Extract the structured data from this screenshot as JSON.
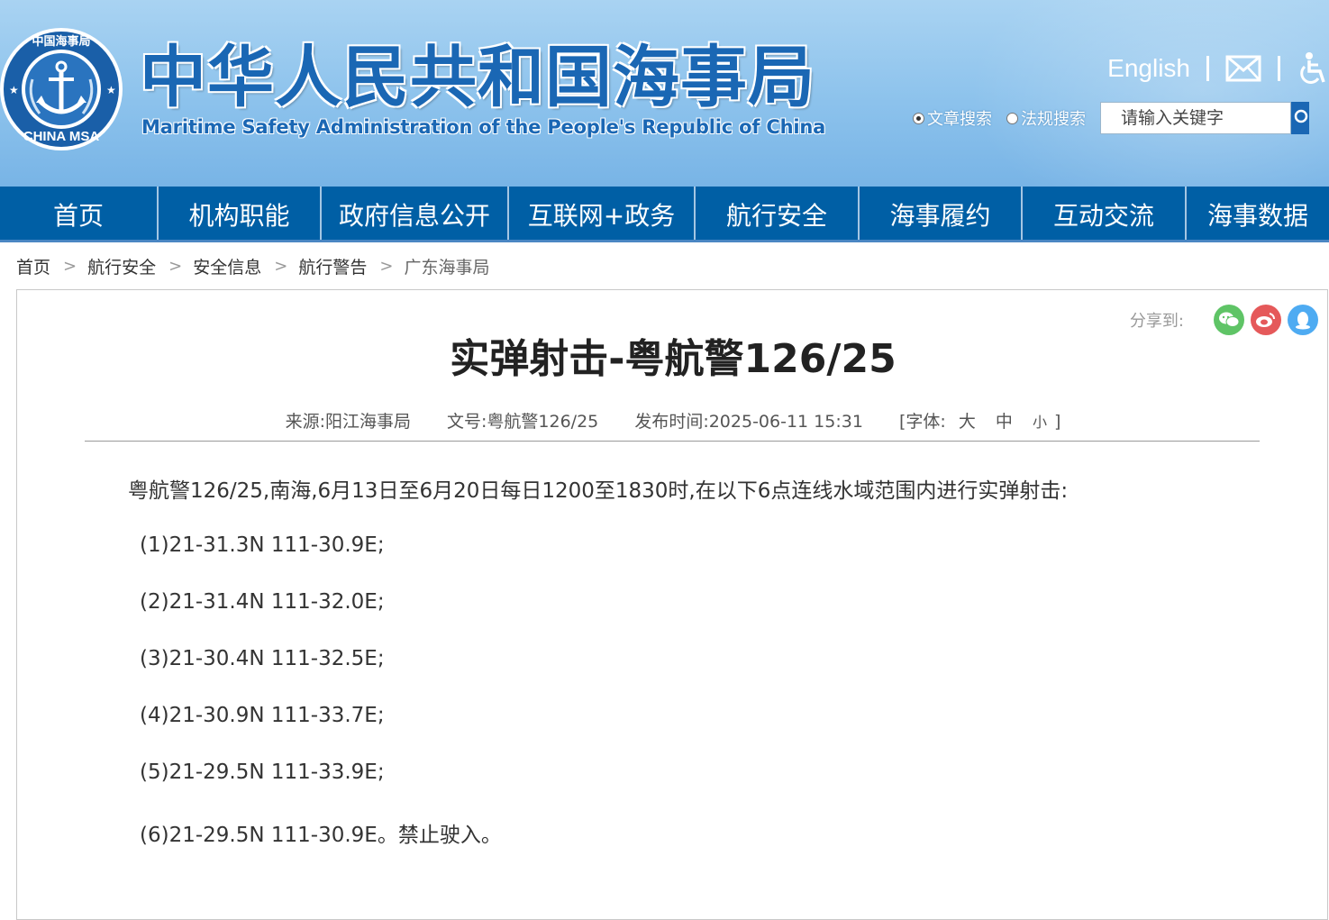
{
  "header": {
    "logo_text": "CHINA MSA",
    "logo_ring_text": "中国海事局",
    "title": "中华人民共和国海事局",
    "subtitle": "Maritime Safety Administration of the People's Republic of China",
    "english_link": "English",
    "search_radio_article": "文章搜索",
    "search_radio_law": "法规搜索",
    "search_placeholder": "请输入关键字"
  },
  "nav": [
    "首页",
    "机构职能",
    "政府信息公开",
    "互联网+政务",
    "航行安全",
    "海事履约",
    "互动交流",
    "海事数据"
  ],
  "breadcrumb": {
    "items": [
      "首页",
      "航行安全",
      "安全信息",
      "航行警告",
      "广东海事局"
    ],
    "separator": ">"
  },
  "share": {
    "label": "分享到:"
  },
  "article": {
    "title": "实弹射击-粤航警126/25",
    "source_label": "来源:阳江海事局",
    "doc_label": "文号:粤航警126/25",
    "time_label": "发布时间:2025-06-11 15:31",
    "font_label": "[字体:",
    "font_large": "大",
    "font_medium": "中",
    "font_small": "小",
    "font_close": "]",
    "intro": "粤航警126/25,南海,6月13日至6月20日每日1200至1830时,在以下6点连线水域范围内进行实弹射击:",
    "points": [
      "(1)21-31.3N 111-30.9E;",
      "(2)21-31.4N 111-32.0E;",
      "(3)21-30.4N 111-32.5E;",
      "(4)21-30.9N 111-33.7E;",
      "(5)21-29.5N 111-33.9E;",
      "(6)21-29.5N 111-30.9E。禁止驶入。"
    ]
  },
  "colors": {
    "nav_bg": "#005fa5",
    "title_blue": "#1a67b4",
    "wechat": "#5fc466",
    "weibo": "#e5595a",
    "qq": "#4eabf2"
  }
}
